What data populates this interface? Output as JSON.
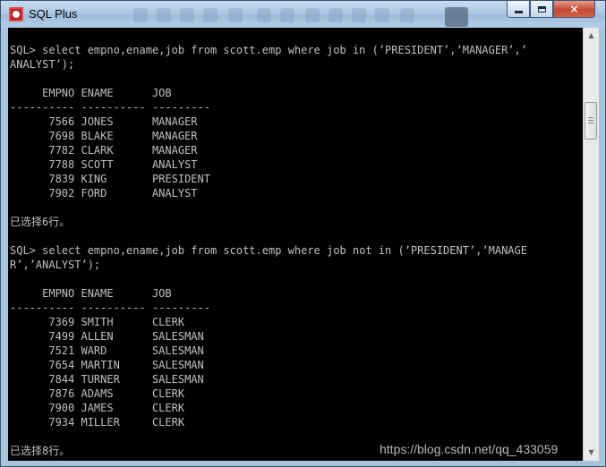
{
  "window": {
    "title": "SQL Plus",
    "controls": {
      "minimize": "",
      "maximize": "",
      "close": "×"
    }
  },
  "console": {
    "lines": [
      "SQL> select empno,ename,job from scott.emp where job in (’PRESIDENT’,’MANAGER’,’",
      "ANALYST’);",
      "",
      "     EMPNO ENAME      JOB",
      "---------- ---------- ---------",
      "      7566 JONES      MANAGER",
      "      7698 BLAKE      MANAGER",
      "      7782 CLARK      MANAGER",
      "      7788 SCOTT      ANALYST",
      "      7839 KING       PRESIDENT",
      "      7902 FORD       ANALYST",
      "",
      "已选择6行。",
      "",
      "SQL> select empno,ename,job from scott.emp where job not in (’PRESIDENT’,’MANAGE",
      "R’,’ANALYST’);",
      "",
      "     EMPNO ENAME      JOB",
      "---------- ---------- ---------",
      "      7369 SMITH      CLERK",
      "      7499 ALLEN      SALESMAN",
      "      7521 WARD       SALESMAN",
      "      7654 MARTIN     SALESMAN",
      "      7844 TURNER     SALESMAN",
      "      7876 ADAMS      CLERK",
      "      7900 JAMES      CLERK",
      "      7934 MILLER     CLERK",
      "",
      "已选择8行。"
    ]
  },
  "watermark": "https://blog.csdn.net/qq_433059",
  "icons": {
    "app": "sqlplus-app-icon",
    "scroll_up": "scroll-up-icon",
    "scroll_down": "scroll-down-icon"
  },
  "colors": {
    "console_bg": "#000000",
    "console_text": "#c0c0c0",
    "titlebar": "#aac6e2",
    "close_button": "#c34a32"
  }
}
